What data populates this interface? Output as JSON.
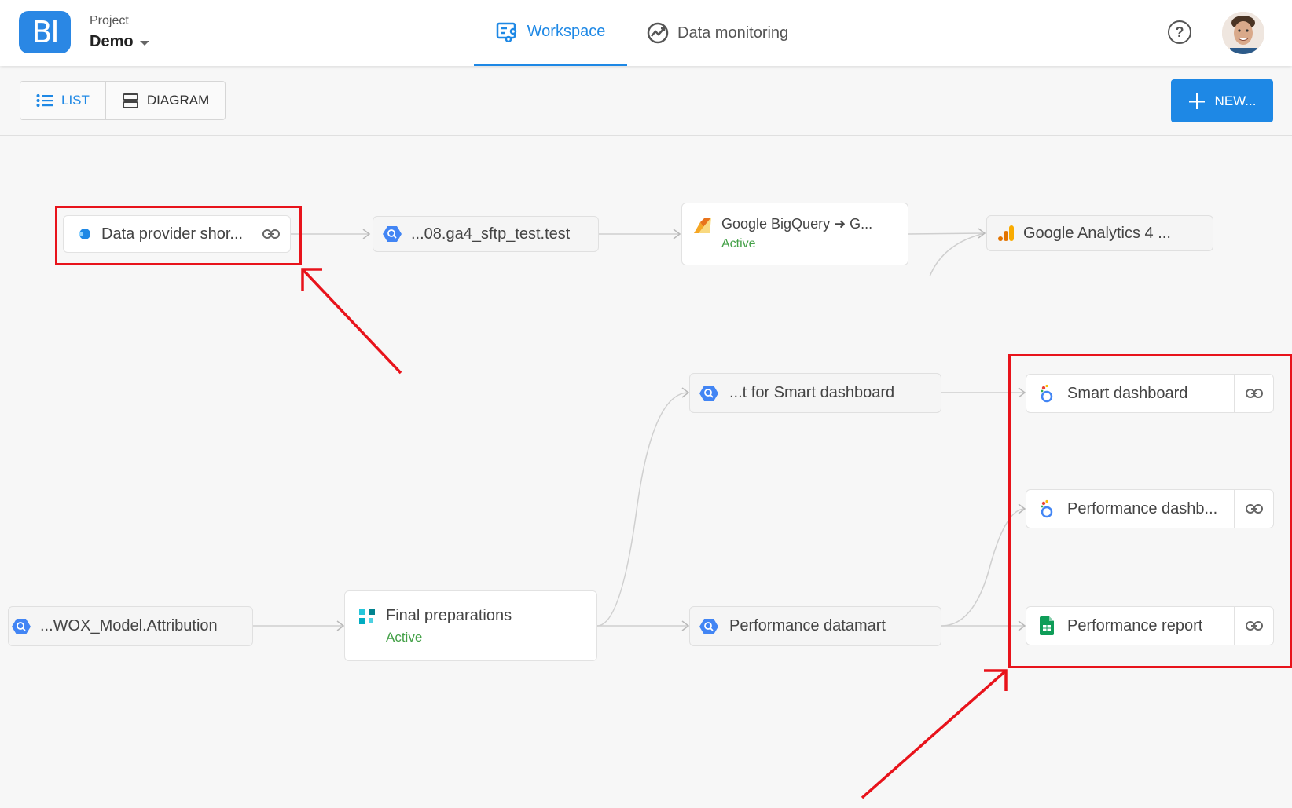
{
  "header": {
    "logo_text": "BI",
    "project_label": "Project",
    "project_name": "Demo",
    "tabs": [
      {
        "label": "Workspace",
        "active": true
      },
      {
        "label": "Data monitoring",
        "active": false
      }
    ],
    "help_label": "?"
  },
  "toolbar": {
    "view_toggle": [
      {
        "label": "LIST",
        "active": true
      },
      {
        "label": "DIAGRAM",
        "active": false
      }
    ],
    "new_button_label": "NEW..."
  },
  "nodes": {
    "data_provider": {
      "label": "Data provider shor...",
      "icon": "data-provider-icon"
    },
    "sftp_test": {
      "label": "...08.ga4_sftp_test.test",
      "icon": "bigquery-icon"
    },
    "bq_to_ga": {
      "label": "Google BigQuery ➜ G...",
      "status": "Active",
      "icon": "transfer-icon"
    },
    "ga4": {
      "label": "Google Analytics 4 ...",
      "icon": "google-analytics-icon"
    },
    "smart_source": {
      "label": "...t for Smart dashboard",
      "icon": "bigquery-icon"
    },
    "smart_dashboard": {
      "label": "Smart dashboard",
      "icon": "looker-studio-icon"
    },
    "perf_dashboard": {
      "label": "Performance dashb...",
      "icon": "looker-studio-icon"
    },
    "attribution": {
      "label": "...WOX_Model.Attribution",
      "icon": "bigquery-icon"
    },
    "final_prep": {
      "label": "Final preparations",
      "status": "Active",
      "icon": "transform-icon"
    },
    "perf_datamart": {
      "label": "Performance datamart",
      "icon": "bigquery-icon"
    },
    "perf_report": {
      "label": "Performance report",
      "icon": "google-sheets-icon"
    }
  },
  "colors": {
    "primary": "#1e88e5",
    "active_status": "#43a047",
    "highlight": "#e8131b"
  }
}
